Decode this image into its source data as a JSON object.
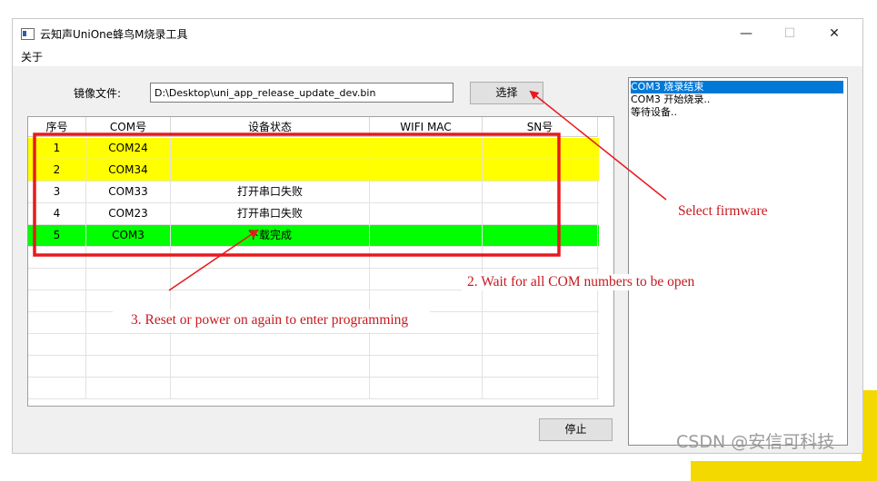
{
  "window": {
    "title": "云知声UniOne蜂鸟M烧录工具",
    "minimize_glyph": "—",
    "maximize_glyph": "☐",
    "close_glyph": "✕"
  },
  "menu": {
    "about": "关于"
  },
  "form": {
    "image_label": "镜像文件:",
    "image_path": "D:\\Desktop\\uni_app_release_update_dev.bin",
    "select_button": "选择",
    "stop_button": "停止"
  },
  "table": {
    "headers": [
      "序号",
      "COM号",
      "设备状态",
      "WIFI MAC",
      "SN号"
    ],
    "rows": [
      {
        "index": "1",
        "com": "COM24",
        "status": "",
        "mac": "",
        "sn": "",
        "color": "#ffff00"
      },
      {
        "index": "2",
        "com": "COM34",
        "status": "",
        "mac": "",
        "sn": "",
        "color": "#ffff00"
      },
      {
        "index": "3",
        "com": "COM33",
        "status": "打开串口失败",
        "mac": "",
        "sn": "",
        "color": "#ffffff"
      },
      {
        "index": "4",
        "com": "COM23",
        "status": "打开串口失败",
        "mac": "",
        "sn": "",
        "color": "#ffffff"
      },
      {
        "index": "5",
        "com": "COM3",
        "status": "下载完成",
        "mac": "",
        "sn": "",
        "color": "#00ff00"
      }
    ]
  },
  "log": {
    "lines": [
      "COM3 烧录结束",
      "COM3 开始烧录..",
      "等待设备.."
    ],
    "selected_color": "#0078d7"
  },
  "annotations": {
    "select_firmware": "Select firmware",
    "wait_com": "2. Wait for all COM numbers to be open",
    "reset_power": "3. Reset or power on again to enter programming",
    "color": "#e8191e"
  },
  "watermark": "CSDN @安信可科技"
}
